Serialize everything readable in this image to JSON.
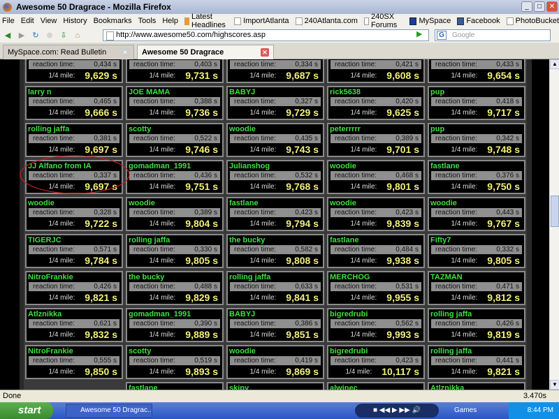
{
  "window": {
    "title": "Awesome 50 Dragrace - Mozilla Firefox"
  },
  "menu": [
    "File",
    "Edit",
    "View",
    "History",
    "Bookmarks",
    "Tools",
    "Help"
  ],
  "bookmarks": [
    {
      "label": "Latest Headlines",
      "icon": "rss"
    },
    {
      "label": "ImportAtlanta",
      "icon": "page"
    },
    {
      "label": "240Atlanta.com",
      "icon": "page"
    },
    {
      "label": "240SX Forums",
      "icon": "page"
    },
    {
      "label": "MySpace",
      "icon": "ms"
    },
    {
      "label": "Facebook",
      "icon": "fb"
    },
    {
      "label": "PhotoBucket",
      "icon": "page"
    }
  ],
  "navbar": {
    "url": "http://www.awesome50.com/highscores.asp",
    "search_placeholder": "Google"
  },
  "tabs": [
    {
      "label": "MySpace.com: Read Bulletin",
      "active": false
    },
    {
      "label": "Awesome 50 Dragrace",
      "active": true
    }
  ],
  "labels": {
    "reaction": "reaction time:",
    "mile": "1/4 mile:"
  },
  "scores": [
    [
      {
        "name": "",
        "rt": "0,434 s",
        "mile": "9,629 s"
      },
      {
        "name": "",
        "rt": "0,403 s",
        "mile": "9,731 s"
      },
      {
        "name": "",
        "rt": "0,334 s",
        "mile": "9,687 s"
      },
      {
        "name": "",
        "rt": "0,421 s",
        "mile": "9,608 s"
      },
      {
        "name": "",
        "rt": "0,433 s",
        "mile": "9,654 s"
      }
    ],
    [
      {
        "name": "larry n",
        "rt": "0,465 s",
        "mile": "9,666 s"
      },
      {
        "name": "JOE MAMA",
        "rt": "0,388 s",
        "mile": "9,736 s"
      },
      {
        "name": "BABYJ",
        "rt": "0,327 s",
        "mile": "9,729 s"
      },
      {
        "name": "rick5638",
        "rt": "0,420 s",
        "mile": "9,625 s"
      },
      {
        "name": "pup",
        "rt": "0,418 s",
        "mile": "9,717 s"
      }
    ],
    [
      {
        "name": "rolling jaffa",
        "rt": "0,381 s",
        "mile": "9,697 s"
      },
      {
        "name": "scotty",
        "rt": "0,522 s",
        "mile": "9,746 s"
      },
      {
        "name": "woodie",
        "rt": "0,435 s",
        "mile": "9,743 s"
      },
      {
        "name": "peterrrrr",
        "rt": "0,389 s",
        "mile": "9,701 s"
      },
      {
        "name": "pup",
        "rt": "0,342 s",
        "mile": "9,748 s"
      }
    ],
    [
      {
        "name": "JJ Alfano from IA",
        "rt": "0,337 s",
        "mile": "9,697 s"
      },
      {
        "name": "gomadman_1991",
        "rt": "0,436 s",
        "mile": "9,751 s"
      },
      {
        "name": "Julianshog",
        "rt": "0,532 s",
        "mile": "9,768 s"
      },
      {
        "name": "woodie",
        "rt": "0,468 s",
        "mile": "9,801 s"
      },
      {
        "name": "fastlane",
        "rt": "0,376 s",
        "mile": "9,750 s"
      }
    ],
    [
      {
        "name": "woodie",
        "rt": "0,328 s",
        "mile": "9,722 s"
      },
      {
        "name": "woodie",
        "rt": "0,389 s",
        "mile": "9,804 s"
      },
      {
        "name": "fastlane",
        "rt": "0,423 s",
        "mile": "9,794 s"
      },
      {
        "name": "woodie",
        "rt": "0,423 s",
        "mile": "9,839 s"
      },
      {
        "name": "woodie",
        "rt": "0,443 s",
        "mile": "9,767 s"
      }
    ],
    [
      {
        "name": "TIGERJC",
        "rt": "0,571 s",
        "mile": "9,784 s"
      },
      {
        "name": "rolling jaffa",
        "rt": "0,330 s",
        "mile": "9,805 s"
      },
      {
        "name": "the bucky",
        "rt": "0,582 s",
        "mile": "9,808 s"
      },
      {
        "name": "fastlane",
        "rt": "0,484 s",
        "mile": "9,938 s"
      },
      {
        "name": "Fifty7",
        "rt": "0,332 s",
        "mile": "9,805 s"
      }
    ],
    [
      {
        "name": "NitroFrankie",
        "rt": "0,426 s",
        "mile": "9,821 s"
      },
      {
        "name": "the bucky",
        "rt": "0,488 s",
        "mile": "9,829 s"
      },
      {
        "name": "rolling jaffa",
        "rt": "0,633 s",
        "mile": "9,841 s"
      },
      {
        "name": "MERCHOG",
        "rt": "0,531 s",
        "mile": "9,955 s"
      },
      {
        "name": "TAZMAN",
        "rt": "0,471 s",
        "mile": "9,812 s"
      }
    ],
    [
      {
        "name": "Atlznikka",
        "rt": "0,621 s",
        "mile": "9,832 s"
      },
      {
        "name": "gomadman_1991",
        "rt": "0,390 s",
        "mile": "9,889 s"
      },
      {
        "name": "BABYJ",
        "rt": "0,386 s",
        "mile": "9,851 s"
      },
      {
        "name": "bigredrubi",
        "rt": "0,562 s",
        "mile": "9,993 s"
      },
      {
        "name": "rolling jaffa",
        "rt": "0,426 s",
        "mile": "9,819 s"
      }
    ],
    [
      {
        "name": "NitroFrankie",
        "rt": "0,555 s",
        "mile": "9,850 s"
      },
      {
        "name": "scotty",
        "rt": "0,519 s",
        "mile": "9,893 s"
      },
      {
        "name": "woodie",
        "rt": "0,419 s",
        "mile": "9,869 s"
      },
      {
        "name": "bigredrubi",
        "rt": "0,423 s",
        "mile": "10,117 s"
      },
      {
        "name": "rolling jaffa",
        "rt": "0,441 s",
        "mile": "9,821 s"
      }
    ],
    [
      {
        "name": "",
        "rt": "",
        "mile": ""
      },
      {
        "name": "fastlane",
        "rt": "",
        "mile": ""
      },
      {
        "name": "skipy",
        "rt": "",
        "mile": ""
      },
      {
        "name": "alwinec",
        "rt": "",
        "mile": ""
      },
      {
        "name": "Atlznikka",
        "rt": "",
        "mile": ""
      }
    ]
  ],
  "status": {
    "text": "Done",
    "timer": "3.470s"
  },
  "taskbar": {
    "start": "start",
    "task": "Awesome 50 Dragrac...",
    "toolbar": "Games",
    "clock": "8:44 PM"
  },
  "colors": {
    "name": "#3ee03e",
    "time": "#f2ef7a",
    "annotation": "#c02020"
  }
}
